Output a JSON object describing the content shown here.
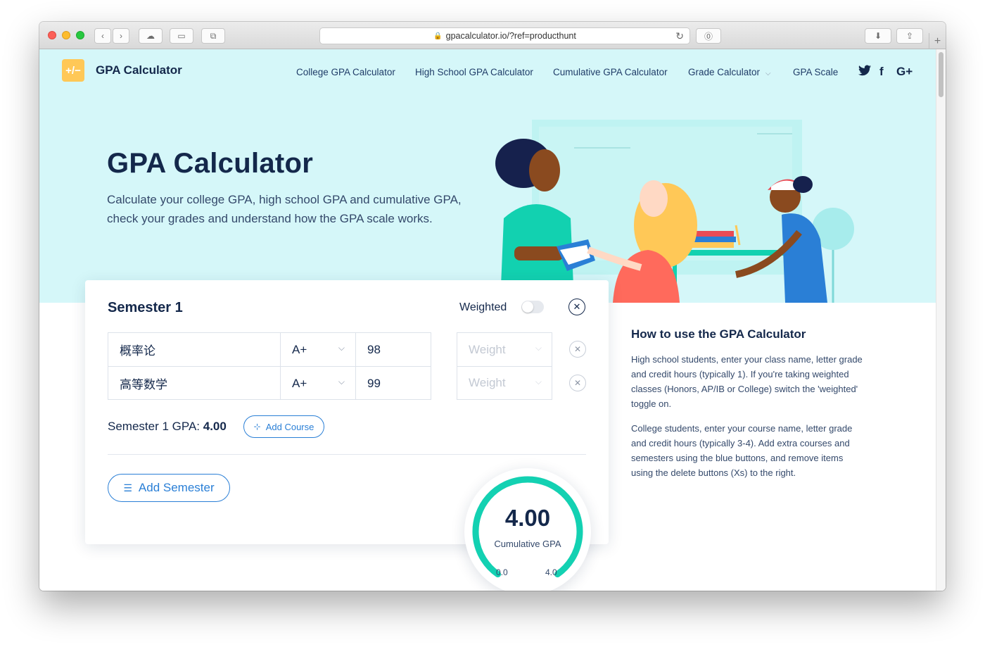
{
  "browser": {
    "url": "gpacalculator.io/?ref=producthunt"
  },
  "nav": {
    "brand": "GPA Calculator",
    "logo_text": "+/−",
    "links": [
      "College GPA Calculator",
      "High School GPA Calculator",
      "Cumulative GPA Calculator",
      "Grade Calculator",
      "GPA Scale"
    ],
    "social": [
      "twitter-icon",
      "facebook-icon",
      "google-plus-icon"
    ],
    "social_glyphs": [
      "🐦",
      "f",
      "G+"
    ]
  },
  "hero": {
    "title": "GPA Calculator",
    "subtitle": "Calculate your college GPA, high school GPA and cumulative GPA, check your grades and understand how the GPA scale works."
  },
  "semester": {
    "title": "Semester 1",
    "weighted_label": "Weighted",
    "weighted_on": false,
    "courses": [
      {
        "name": "概率论",
        "grade": "A+",
        "credits": "98",
        "weight_placeholder": "Weight"
      },
      {
        "name": "高等数学",
        "grade": "A+",
        "credits": "99",
        "weight_placeholder": "Weight"
      }
    ],
    "gpa_label": "Semester 1 GPA:",
    "gpa_value": "4.00",
    "add_course_label": "Add Course",
    "add_semester_label": "Add Semester"
  },
  "gauge": {
    "value": "4.00",
    "label": "Cumulative GPA",
    "min": "0.0",
    "max": "4.0",
    "fill_fraction": 1.0
  },
  "howto": {
    "title": "How to use the GPA Calculator",
    "p1": "High school students, enter your class name, letter grade and credit hours (typically 1). If you're taking weighted classes (Honors, AP/IB or College) switch the 'weighted' toggle on.",
    "p2": "College students, enter your course name, letter grade and credit hours (typically 3-4). Add extra courses and semesters using the blue buttons, and remove items using the delete buttons (Xs) to the right."
  },
  "colors": {
    "hero_bg": "#d5f7f9",
    "accent_blue": "#2a7fd6",
    "gauge_teal": "#13d1b2",
    "navy": "#14284b",
    "logo_yellow": "#ffc857"
  }
}
